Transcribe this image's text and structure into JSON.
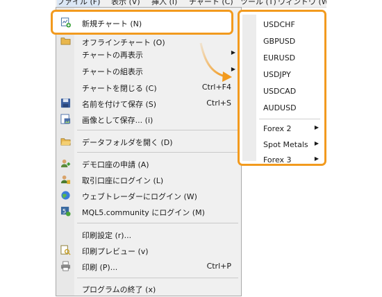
{
  "menubar": {
    "items": [
      "ファイル (F)",
      "表示 (V)",
      "挿入 (I)",
      "チャート (C)",
      "ツール (T)",
      "ウィンドウ (W)"
    ]
  },
  "file_menu": {
    "new_chart": "新規チャート (N)",
    "open_offline": "オフラインチャート (O)",
    "items": [
      {
        "label": "チャートの再表示",
        "shortcut": "",
        "submenu": true,
        "icon": ""
      },
      {
        "label": "チャートの組表示",
        "shortcut": "",
        "submenu": true,
        "icon": ""
      },
      {
        "label": "チャートを閉じる (C)",
        "shortcut": "Ctrl+F4",
        "submenu": false,
        "icon": ""
      },
      {
        "label": "名前を付けて保存 (S)",
        "shortcut": "Ctrl+S",
        "submenu": false,
        "icon": "save-icon"
      },
      {
        "label": "画像として保存... (i)",
        "shortcut": "",
        "submenu": false,
        "icon": "save-image-icon"
      },
      {
        "label": "データフォルダを開く (D)",
        "shortcut": "",
        "submenu": false,
        "icon": "folder-icon"
      },
      {
        "label": "デモ口座の申請 (A)",
        "shortcut": "",
        "submenu": false,
        "icon": "demo-account-icon"
      },
      {
        "label": "取引口座にログイン (L)",
        "shortcut": "",
        "submenu": false,
        "icon": "login-icon"
      },
      {
        "label": "ウェブトレーダーにログイン (W)",
        "shortcut": "",
        "submenu": false,
        "icon": "web-trader-icon"
      },
      {
        "label": "MQL5.community にログイン (M)",
        "shortcut": "",
        "submenu": false,
        "icon": "mql5-icon"
      },
      {
        "label": "印刷設定 (r)...",
        "shortcut": "",
        "submenu": false,
        "icon": ""
      },
      {
        "label": "印刷プレビュー (v)",
        "shortcut": "",
        "submenu": false,
        "icon": "print-preview-icon"
      },
      {
        "label": "印刷 (P)...",
        "shortcut": "Ctrl+P",
        "submenu": false,
        "icon": "printer-icon"
      },
      {
        "label": "プログラムの終了 (x)",
        "shortcut": "",
        "submenu": false,
        "icon": ""
      }
    ]
  },
  "submenu": {
    "symbols": [
      "USDCHF",
      "GBPUSD",
      "EURUSD",
      "USDJPY",
      "USDCAD",
      "AUDUSD"
    ],
    "groups": [
      "Forex 2",
      "Spot Metals",
      "Forex 3"
    ]
  },
  "colors": {
    "highlight_border": "#f29a1e",
    "menu_bg": "#f0f0f0"
  }
}
